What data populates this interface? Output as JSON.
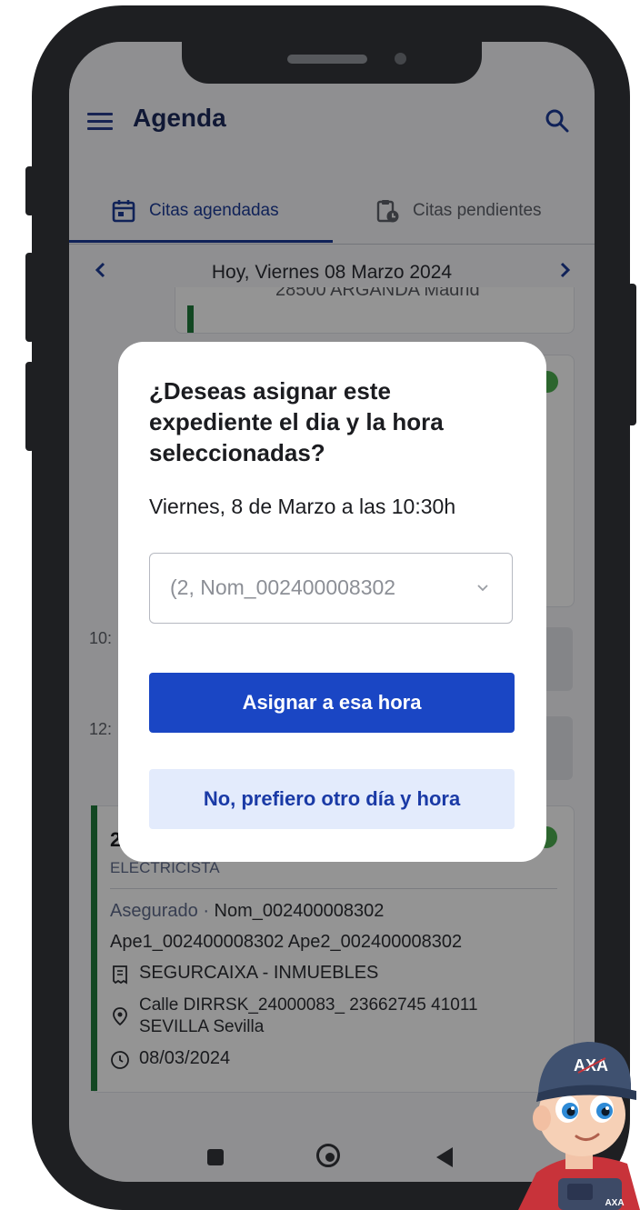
{
  "app": {
    "title": "Agenda",
    "tabs": [
      {
        "label": "Citas agendadas",
        "active": true
      },
      {
        "label": "Citas pendientes",
        "active": false
      }
    ],
    "date_nav": {
      "label": "Hoy, Viernes 08 Marzo 2024"
    }
  },
  "background": {
    "clipped_address": "28500 ARGANDA Madrid",
    "time_slots": [
      "10:",
      "12:"
    ],
    "card": {
      "number_prefix": "2",
      "trade": "ELECTRICISTA",
      "insured_label": "Asegurado",
      "insured_name": "Nom_002400008302",
      "surnames": "Ape1_002400008302 Ape2_002400008302",
      "company": "SEGURCAIXA - INMUEBLES",
      "address_line1": "Calle DIRRSK_24000083_ 23662745 41011",
      "address_line2": "SEVILLA Sevilla",
      "date": "08/03/2024"
    }
  },
  "dialog": {
    "title": "¿Deseas asignar este expediente el dia y la hora seleccionadas?",
    "subtitle": "Viernes, 8 de Marzo a las 10:30h",
    "select_value": "(2, Nom_002400008302",
    "primary_button": "Asignar a esa hora",
    "secondary_button": "No, prefiero otro día y hora"
  },
  "mascot": {
    "cap_brand": "AXA",
    "badge_brand": "AXA"
  },
  "colors": {
    "primary": "#1a46c4",
    "secondary_bg": "#e3ebfc",
    "accent_green": "#1f7a3c",
    "brand_navy": "#1d2a5c"
  },
  "icons": [
    "menu-icon",
    "search-icon",
    "calendar-icon",
    "clipboard-clock-icon",
    "chevron-left-icon",
    "chevron-right-icon",
    "chevron-down-icon",
    "document-icon",
    "location-pin-icon",
    "clock-icon"
  ]
}
